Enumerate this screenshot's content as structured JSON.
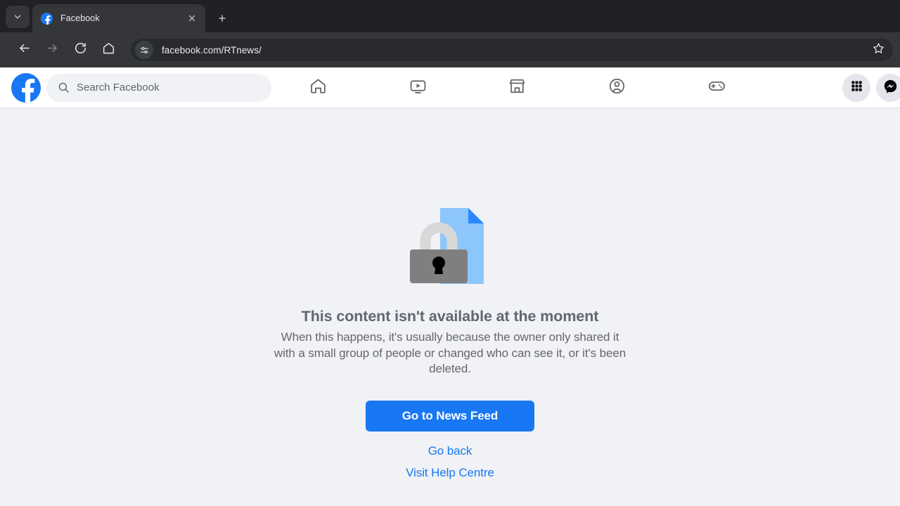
{
  "browser": {
    "tab_search_icon": "chevron-down-icon",
    "tabs": [
      {
        "title": "Facebook",
        "favicon": "facebook-favicon",
        "active": true
      }
    ],
    "new_tab_label": "+",
    "nav": {
      "back_icon": "back-arrow-icon",
      "forward_icon": "forward-arrow-icon",
      "reload_icon": "reload-icon",
      "home_icon": "home-icon"
    },
    "omnibox": {
      "site_settings_icon": "site-settings-sliders-icon",
      "url": "facebook.com/RTnews/",
      "bookmark_icon": "bookmark-star-icon"
    },
    "colors": {
      "tabstrip_bg": "#202124",
      "toolbar_bg": "#35363a",
      "omnibox_bg": "#292a2d",
      "chrome_text": "#e8eaed"
    }
  },
  "facebook": {
    "logo_icon": "facebook-logo-icon",
    "search": {
      "icon": "search-icon",
      "placeholder": "Search Facebook",
      "value": ""
    },
    "nav_tabs": [
      {
        "name": "home",
        "icon": "home-icon"
      },
      {
        "name": "video",
        "icon": "video-play-icon"
      },
      {
        "name": "marketplace",
        "icon": "marketplace-store-icon"
      },
      {
        "name": "groups",
        "icon": "groups-people-icon"
      },
      {
        "name": "gaming",
        "icon": "gamepad-icon"
      }
    ],
    "right_actions": [
      {
        "name": "menu",
        "icon": "grid-menu-icon"
      },
      {
        "name": "messenger",
        "icon": "messenger-icon"
      }
    ],
    "colors": {
      "brand_blue": "#1877f2",
      "nav_bg": "#ffffff",
      "page_bg": "#f0f2f5",
      "text_secondary": "#606770"
    }
  },
  "error_page": {
    "illustration": {
      "name": "locked-document-illustration",
      "document_color": "#8dc6fb",
      "fold_color": "#2d88ff",
      "lock_body_color": "#7f7f7f",
      "lock_shackle_color": "#d8d8d8",
      "keyhole_color": "#000000"
    },
    "title": "This content isn't available at the moment",
    "body": "When this happens, it's usually because the owner only shared it with a small group of people or changed who can see it, or it's been deleted.",
    "primary_button": "Go to News Feed",
    "links": [
      {
        "label": "Go back"
      },
      {
        "label": "Visit Help Centre"
      }
    ]
  }
}
